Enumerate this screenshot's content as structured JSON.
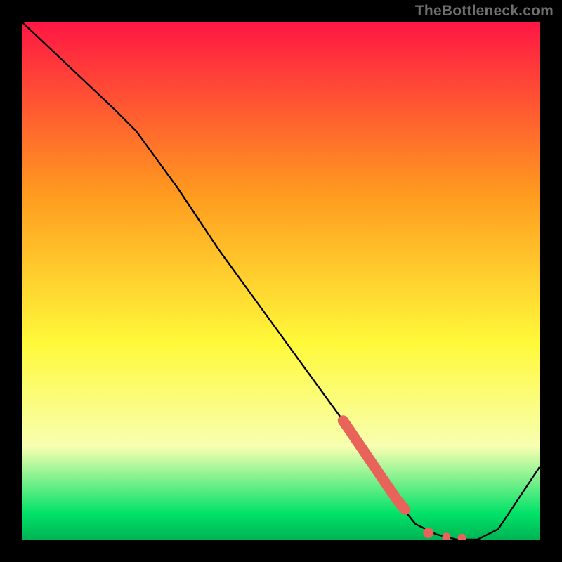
{
  "attribution": "TheBottleneck.com",
  "colors": {
    "bg_black": "#000000",
    "top_red": "#ff1744",
    "mid_orange": "#ff9a1f",
    "yellow": "#fff93a",
    "cream": "#f8ffb1",
    "green_bottom": "#00e268",
    "green_edge": "#00b454",
    "curve": "#000000",
    "accent_dot": "#e8645a"
  },
  "chart_data": {
    "type": "line",
    "title": "",
    "xlabel": "",
    "ylabel": "",
    "xlim": [
      0,
      100
    ],
    "ylim": [
      0,
      100
    ],
    "x": [
      0,
      18,
      22,
      30,
      38,
      46,
      54,
      62,
      68,
      72,
      76,
      80,
      84,
      88,
      92,
      100
    ],
    "values": [
      100,
      83,
      79,
      68,
      56,
      45,
      34,
      23,
      14,
      8,
      3,
      1,
      0,
      0,
      2,
      14
    ],
    "accent_segment": {
      "x": [
        62,
        63.5,
        65,
        66.5,
        68,
        69.5,
        71,
        72.5,
        74
      ],
      "values": [
        23,
        20.8,
        18.6,
        16.4,
        14.2,
        12.0,
        9.8,
        7.6,
        5.8
      ]
    },
    "accent_dots_extra": {
      "x": [
        78.5,
        82,
        85
      ],
      "values": [
        1.3,
        0.5,
        0.3
      ]
    }
  }
}
